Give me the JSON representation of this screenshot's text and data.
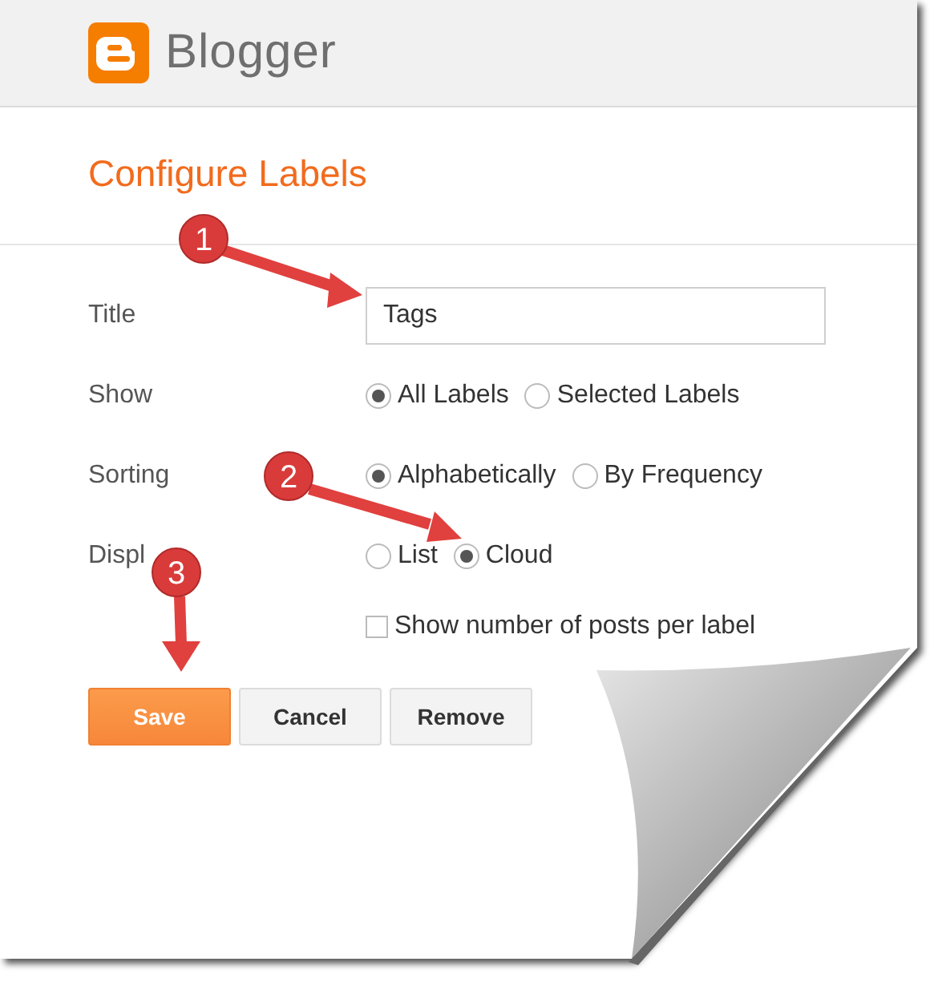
{
  "header": {
    "brand": "Blogger"
  },
  "title": "Configure Labels",
  "form": [
    {
      "kind": "text",
      "label": "Title",
      "value": "Tags"
    },
    {
      "kind": "radio",
      "label": "Show",
      "options": [
        {
          "label": "All Labels",
          "selected": true
        },
        {
          "label": "Selected Labels",
          "selected": false
        }
      ]
    },
    {
      "kind": "radio",
      "label": "Sorting",
      "options": [
        {
          "label": "Alphabetically",
          "selected": true
        },
        {
          "label": "By Frequency",
          "selected": false
        }
      ]
    },
    {
      "kind": "radio",
      "label": "Displ",
      "options": [
        {
          "label": "List",
          "selected": false
        },
        {
          "label": "Cloud",
          "selected": true
        }
      ]
    },
    {
      "kind": "checkbox",
      "option": {
        "label": "Show number of posts per label",
        "checked": false
      }
    }
  ],
  "buttons": [
    {
      "label": "Save",
      "kind": "primary"
    },
    {
      "label": "Cancel",
      "kind": "plain"
    },
    {
      "label": "Remove",
      "kind": "plain"
    }
  ],
  "annotations": [
    {
      "number": "1"
    },
    {
      "number": "2"
    },
    {
      "number": "3"
    }
  ]
}
